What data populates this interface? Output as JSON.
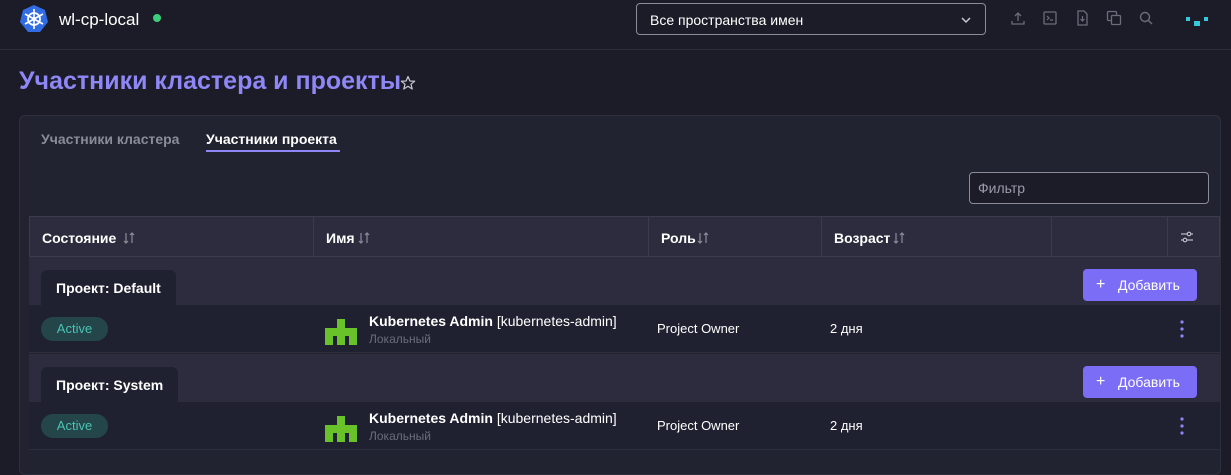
{
  "header": {
    "cluster_name": "wl-cp-local",
    "namespace_select": "Все пространства имен",
    "icons": [
      "upload-icon",
      "terminal-icon",
      "download-icon",
      "copy-icon",
      "search-icon"
    ]
  },
  "page": {
    "title": "Участники кластера и проекты"
  },
  "tabs": [
    {
      "label": "Участники кластера",
      "active": false
    },
    {
      "label": "Участники проекта",
      "active": true
    }
  ],
  "filter": {
    "placeholder": "Фильтр"
  },
  "table": {
    "columns": [
      "Состояние",
      "Имя",
      "Роль",
      "Возраст"
    ],
    "groups": [
      {
        "label": "Проект: Default",
        "add_label": "Добавить",
        "rows": [
          {
            "state": "Active",
            "name": "Kubernetes Admin",
            "id": "[kubernetes-admin]",
            "sub": "Локальный",
            "role": "Project Owner",
            "age": "2 дня"
          }
        ]
      },
      {
        "label": "Проект: System",
        "add_label": "Добавить",
        "rows": [
          {
            "state": "Active",
            "name": "Kubernetes Admin",
            "id": "[kubernetes-admin]",
            "sub": "Локальный",
            "role": "Project Owner",
            "age": "2 дня"
          }
        ]
      }
    ]
  },
  "colors": {
    "accent": "#8e87f5",
    "button": "#7b6df5",
    "active_badge_bg": "#24454a",
    "active_badge_text": "#4cc2b4",
    "status_ok": "#3ad07b",
    "user_icon": "#6ac22a"
  }
}
